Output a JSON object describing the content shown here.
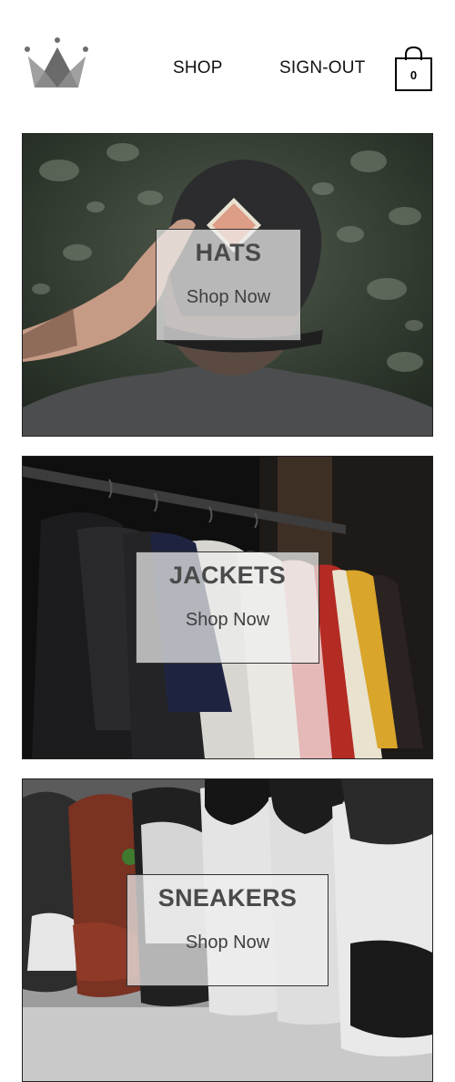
{
  "header": {
    "logo_icon": "crown-icon",
    "nav": [
      {
        "label": "SHOP"
      },
      {
        "label": "SIGN-OUT"
      }
    ],
    "cart": {
      "icon": "shopping-bag-icon",
      "count": "0"
    }
  },
  "categories": [
    {
      "title": "HATS",
      "cta": "Shop Now"
    },
    {
      "title": "JACKETS",
      "cta": "Shop Now"
    },
    {
      "title": "SNEAKERS",
      "cta": "Shop Now"
    }
  ],
  "colors": {
    "text": "#111111",
    "label_bg": "#eeeeee",
    "label_text": "#4a4a4a",
    "logo": "#808080"
  }
}
